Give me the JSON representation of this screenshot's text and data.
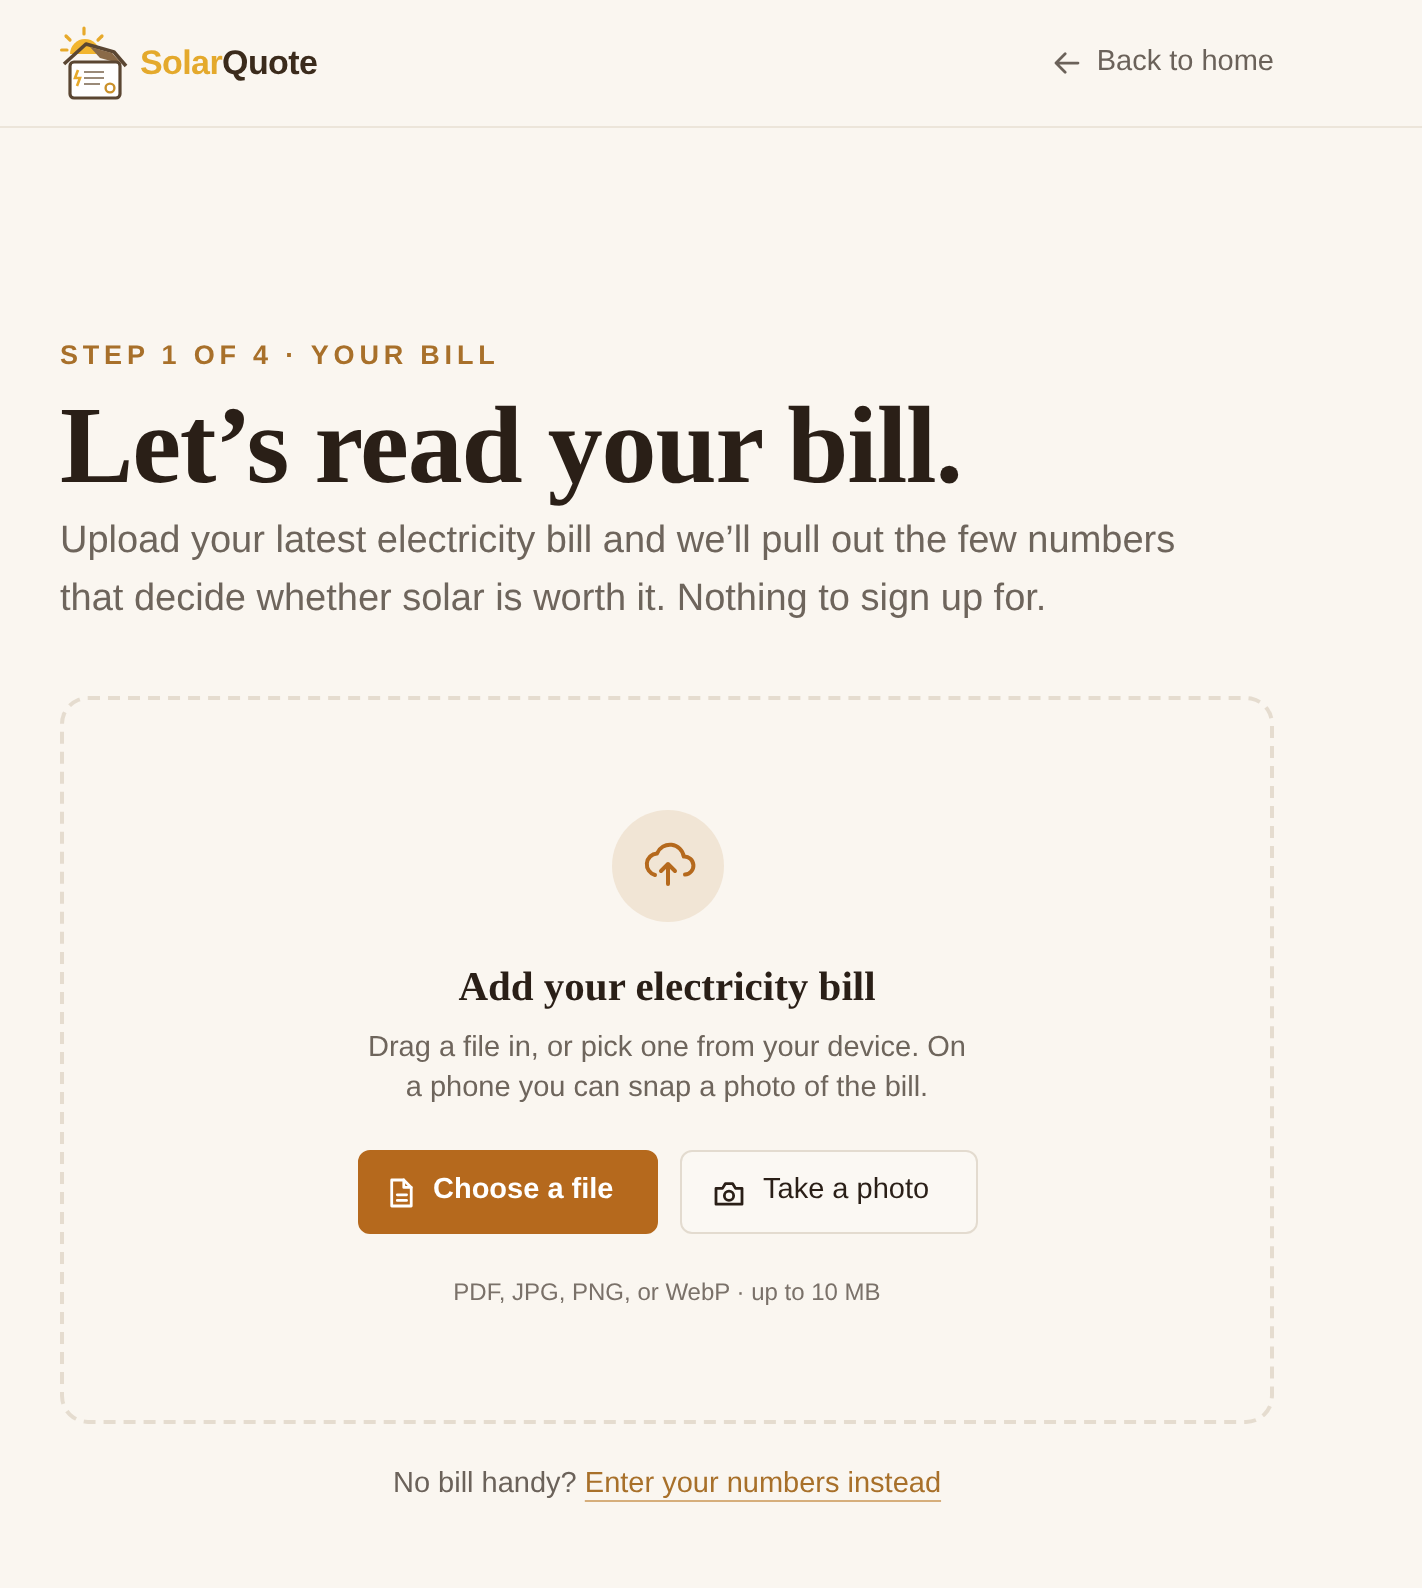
{
  "header": {
    "brand": {
      "first": "Solar",
      "second": "Quote"
    },
    "back_link": "Back to home"
  },
  "intro": {
    "eyebrow": "STEP 1 OF 4 · YOUR BILL",
    "title": "Let’s read your bill.",
    "description": "Upload your latest electricity bill and we’ll pull out the few numbers that decide whether solar is worth it. Nothing to sign up for."
  },
  "upload": {
    "title": "Add your electricity bill",
    "description": "Drag a file in, or pick one from your device. On a phone you can snap a photo of the bill.",
    "buttons": [
      {
        "kind": "primary",
        "label": "Choose a file"
      },
      {
        "kind": "secondary",
        "label": "Take a photo"
      }
    ],
    "formats": "PDF, JPG, PNG, or WebP · up to 10 MB"
  },
  "footer": {
    "prompt": "No bill handy?",
    "link": "Enter your numbers instead"
  }
}
